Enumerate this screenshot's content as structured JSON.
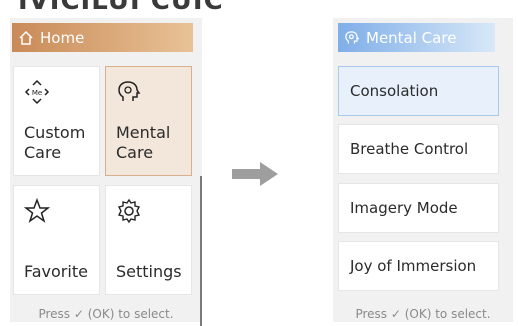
{
  "top_title_partial": "IVICILUI CUIC",
  "left_screen": {
    "header": {
      "title": "Home",
      "icon": "home-icon",
      "color": "#d9a474"
    },
    "tiles": [
      {
        "label": "Custom\nCare",
        "icon": "me-arrows-icon",
        "selected": false
      },
      {
        "label": "Mental\nCare",
        "icon": "head-icon",
        "selected": true
      },
      {
        "label": "Favorite",
        "icon": "star-icon",
        "selected": false
      },
      {
        "label": "Settings",
        "icon": "gear-icon",
        "selected": false
      }
    ],
    "hint": "Press ✓ (OK) to select."
  },
  "arrow": {
    "icon": "right-arrow-icon",
    "color": "#9e9e9e"
  },
  "right_screen": {
    "header": {
      "title": "Mental Care",
      "icon": "head-icon",
      "color": "#8ab8ee"
    },
    "menu": [
      {
        "label": "Consolation",
        "selected": true
      },
      {
        "label": "Breathe Control",
        "selected": false
      },
      {
        "label": "Imagery Mode",
        "selected": false
      },
      {
        "label": "Joy of Immersion",
        "selected": false
      }
    ],
    "hint": "Press ✓ (OK) to select."
  }
}
